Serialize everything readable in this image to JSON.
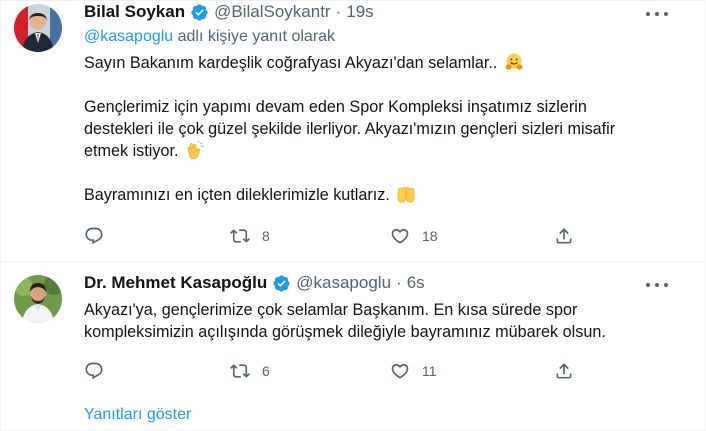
{
  "tweets": [
    {
      "name": "Bilal Soykan",
      "handle": "@BilalSoykantr",
      "separator": "·",
      "time": "19s",
      "reply_mention": "@kasapoglu",
      "reply_suffix": " adlı kişiye yanıt olarak",
      "paragraphs": [
        "Sayın Bakanım kardeşlik coğrafyası Akyazı'dan selamlar..",
        "Gençlerimiz için yapımı devam eden Spor Kompleksi inşatımız sizlerin destekleri ile çok güzel şekilde ilerliyor. Akyazı'mızın gençleri sizleri misafir etmek istiyor.",
        "Bayramınızı en içten dileklerimizle kutlarız."
      ],
      "emojis": [
        "hugging-face",
        "clapping-hands",
        "open-hands"
      ],
      "actions": {
        "replies": "",
        "retweets": "8",
        "likes": "18"
      }
    },
    {
      "name": "Dr. Mehmet Kasapoğlu",
      "handle": "@kasapoglu",
      "separator": "·",
      "time": "6s",
      "paragraphs": [
        "Akyazı'ya, gençlerimize çok selamlar Başkanım. En kısa sürede spor kompleksimizin açılışında görüşmek dileğiyle bayramınız mübarek olsun."
      ],
      "actions": {
        "replies": "",
        "retweets": "6",
        "likes": "11"
      }
    }
  ],
  "show_replies_label": "Yanıtları göster",
  "colors": {
    "accent": "#1d9bf0",
    "text": "#0f1419",
    "secondary": "#536471",
    "border": "#eff3f4"
  },
  "icons": [
    "verified-badge-icon",
    "more-icon",
    "reply-icon",
    "retweet-icon",
    "like-icon",
    "share-icon"
  ]
}
